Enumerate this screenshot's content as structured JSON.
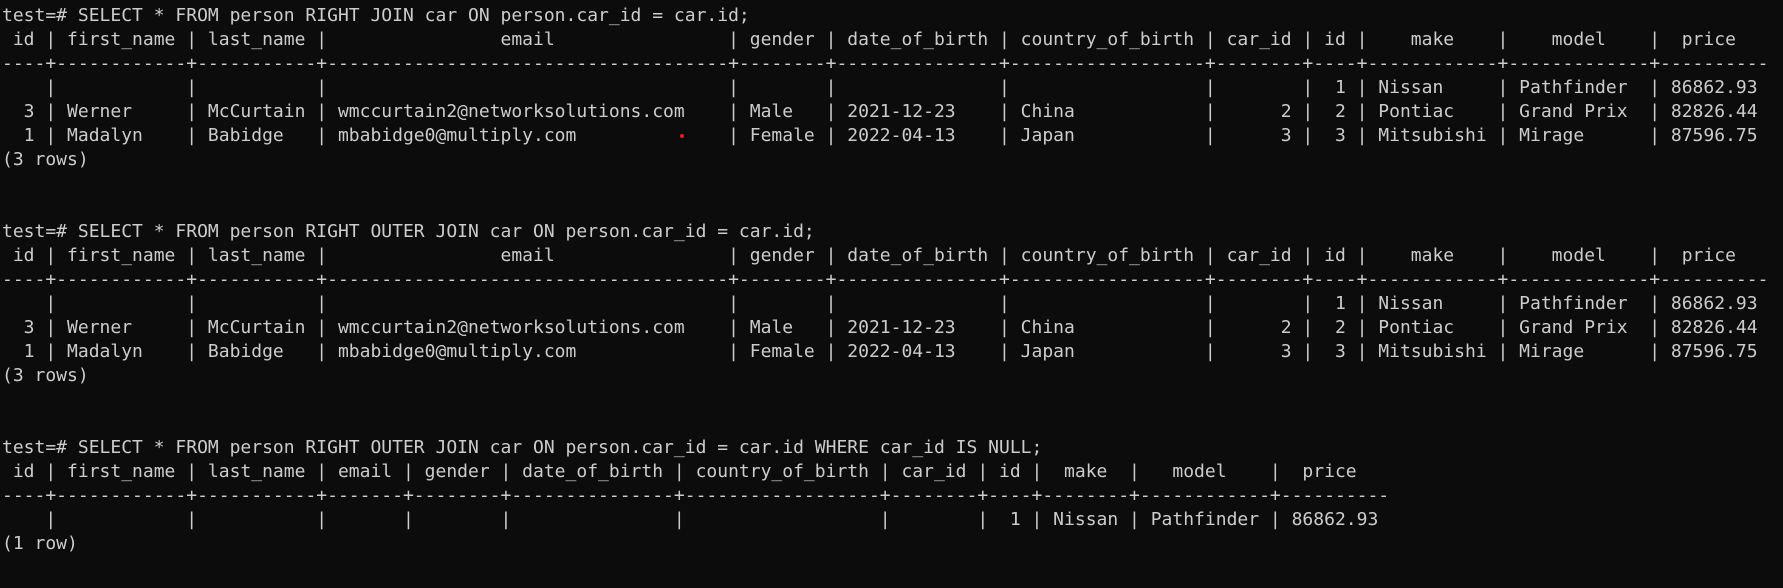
{
  "terminal": {
    "lines": [
      "test=# SELECT * FROM person RIGHT JOIN car ON person.car_id = car.id;",
      " id | first_name | last_name |                email                | gender | date_of_birth | country_of_birth | car_id | id |    make    |    model    |  price",
      "----+------------+-----------+-------------------------------------+--------+---------------+------------------+--------+----+------------+-------------+----------",
      "    |            |           |                                     |        |               |                  |        |  1 | Nissan     | Pathfinder  | 86862.93",
      "  3 | Werner     | McCurtain | wmccurtain2@networksolutions.com    | Male   | 2021-12-23    | China            |      2 |  2 | Pontiac    | Grand Prix  | 82826.44",
      "  1 | Madalyn    | Babidge   | mbabidge0@multiply.com              | Female | 2022-04-13    | Japan            |      3 |  3 | Mitsubishi | Mirage      | 87596.75",
      "(3 rows)",
      "",
      "",
      "test=# SELECT * FROM person RIGHT OUTER JOIN car ON person.car_id = car.id;",
      " id | first_name | last_name |                email                | gender | date_of_birth | country_of_birth | car_id | id |    make    |    model    |  price",
      "----+------------+-----------+-------------------------------------+--------+---------------+------------------+--------+----+------------+-------------+----------",
      "    |            |           |                                     |        |               |                  |        |  1 | Nissan     | Pathfinder  | 86862.93",
      "  3 | Werner     | McCurtain | wmccurtain2@networksolutions.com    | Male   | 2021-12-23    | China            |      2 |  2 | Pontiac    | Grand Prix  | 82826.44",
      "  1 | Madalyn    | Babidge   | mbabidge0@multiply.com              | Female | 2022-04-13    | Japan            |      3 |  3 | Mitsubishi | Mirage      | 87596.75",
      "(3 rows)",
      "",
      "",
      "test=# SELECT * FROM person RIGHT OUTER JOIN car ON person.car_id = car.id WHERE car_id IS NULL;",
      " id | first_name | last_name | email | gender | date_of_birth | country_of_birth | car_id | id |  make  |   model    |  price",
      "----+------------+-----------+-------+--------+---------------+------------------+--------+----+--------+------------+----------",
      "    |            |           |       |        |               |                  |        |  1 | Nissan | Pathfinder | 86862.93",
      "(1 row)",
      ""
    ]
  }
}
